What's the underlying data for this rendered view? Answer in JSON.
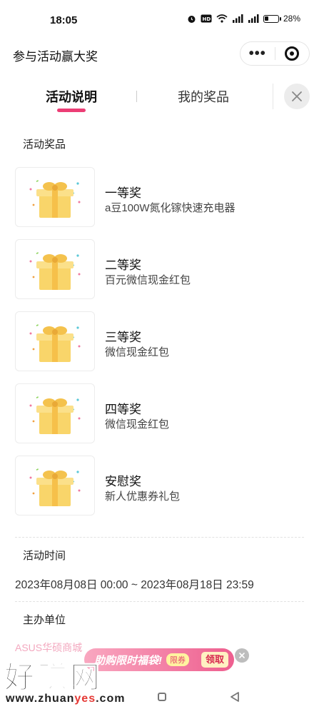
{
  "status_bar": {
    "time": "18:05",
    "battery": "28%",
    "battery_level": 0.28,
    "icons": [
      "alarm-icon",
      "hd-icon",
      "wifi-icon",
      "signal-icon",
      "signal-icon",
      "battery-icon"
    ]
  },
  "header": {
    "title": "参与活动赢大奖",
    "more_label": "•••"
  },
  "tabs": [
    {
      "label": "活动说明",
      "active": true
    },
    {
      "label": "我的奖品",
      "active": false
    }
  ],
  "prizes_section": {
    "label": "活动奖品",
    "items": [
      {
        "name": "一等奖",
        "desc": "a豆100W氮化镓快速充电器"
      },
      {
        "name": "二等奖",
        "desc": "百元微信现金红包"
      },
      {
        "name": "三等奖",
        "desc": "微信现金红包"
      },
      {
        "name": "四等奖",
        "desc": "微信现金红包"
      },
      {
        "name": "安慰奖",
        "desc": "新人优惠券礼包"
      }
    ]
  },
  "time_section": {
    "label": "活动时间",
    "value": "2023年08月08日 00:00 ~ 2023年08月18日 23:59"
  },
  "organizer_section": {
    "label": "主办单位",
    "value": "ASUS华硕商城"
  },
  "float_banner": {
    "text": "助购限时福袋!",
    "tag": "限券",
    "claim": "领取"
  },
  "watermark": {
    "big": "好赚网",
    "url_a": "www.zhuan",
    "url_b": "yes",
    "url_c": ".com"
  },
  "colors": {
    "accent": "#ec3d75",
    "label_bg": "#fde6ee",
    "organizer": "#f3a8bf"
  }
}
